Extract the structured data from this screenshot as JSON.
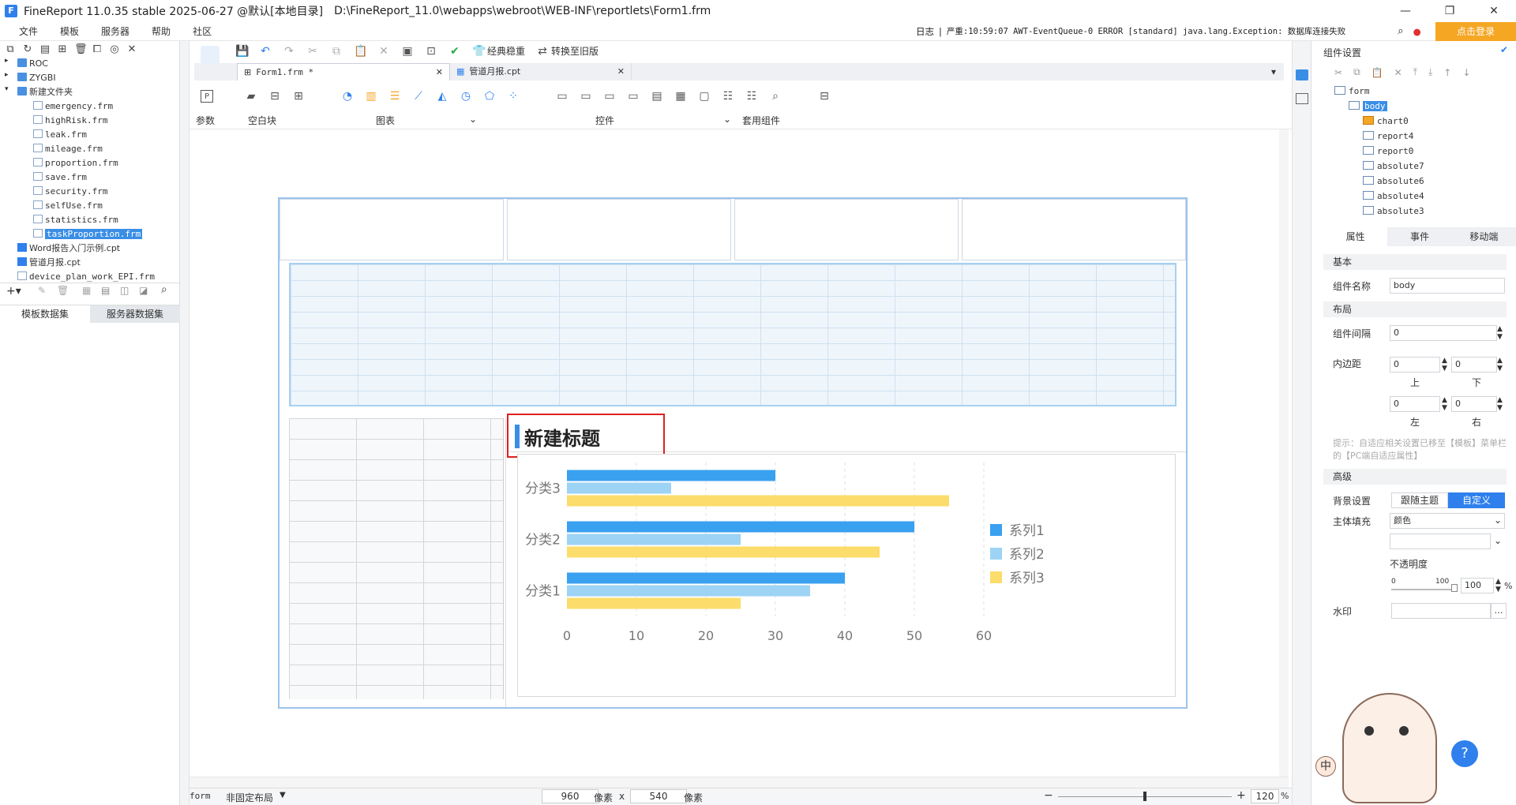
{
  "window": {
    "app_name": "FineReport 11.0.35 stable 2025-06-27 @默认[本地目录]",
    "file_path": "D:\\FineReport_11.0\\webapps\\webroot\\WEB-INF\\reportlets\\Form1.frm",
    "min": "—",
    "max": "❐",
    "close": "✕"
  },
  "menu": [
    "文件",
    "模板",
    "服务器",
    "帮助",
    "社区"
  ],
  "status": {
    "log_label": "日志",
    "separator": "|",
    "message": "严重:10:59:07 AWT-EventQueue-0 ERROR [standard] java.lang.Exception: 数据库连接失败",
    "login": "点击登录"
  },
  "left_tree": [
    {
      "label": "ROC",
      "type": "folder",
      "indent": 0
    },
    {
      "label": "ZYGBI",
      "type": "folder",
      "indent": 0
    },
    {
      "label": "新建文件夹",
      "type": "folder",
      "indent": 0
    },
    {
      "label": "emergency.frm",
      "type": "file",
      "indent": 1
    },
    {
      "label": "highRisk.frm",
      "type": "file",
      "indent": 1
    },
    {
      "label": "leak.frm",
      "type": "file",
      "indent": 1
    },
    {
      "label": "mileage.frm",
      "type": "file",
      "indent": 1
    },
    {
      "label": "proportion.frm",
      "type": "file",
      "indent": 1
    },
    {
      "label": "save.frm",
      "type": "file",
      "indent": 1
    },
    {
      "label": "security.frm",
      "type": "file",
      "indent": 1
    },
    {
      "label": "selfUse.frm",
      "type": "file",
      "indent": 1
    },
    {
      "label": "statistics.frm",
      "type": "file",
      "indent": 1
    },
    {
      "label": "taskProportion.frm",
      "type": "file",
      "indent": 1,
      "selected": true
    },
    {
      "label": "Word报告入门示例.cpt",
      "type": "cpt",
      "indent": 0
    },
    {
      "label": "管道月报.cpt",
      "type": "cpt",
      "indent": 0
    },
    {
      "label": "device_plan_work_EPI.frm",
      "type": "file",
      "indent": 0
    }
  ],
  "left_tabs": [
    "模板数据集",
    "服务器数据集"
  ],
  "toolbar": {
    "classic_stable": "经典稳重",
    "convert_old": "转换至旧版",
    "tab_form1": "Form1.frm *",
    "tab_monthly": "管道月报.cpt",
    "sections": [
      "参数",
      "空白块",
      "图表",
      "控件",
      "套用组件"
    ]
  },
  "chart_title": "新建标题",
  "chart_data": {
    "type": "bar",
    "orientation": "horizontal",
    "title": "",
    "categories": [
      "分类1",
      "分类2",
      "分类3"
    ],
    "series": [
      {
        "name": "系列1",
        "values": [
          40,
          50,
          30
        ],
        "color": "#3aa0f0"
      },
      {
        "name": "系列2",
        "values": [
          35,
          25,
          15
        ],
        "color": "#9dd3f5"
      },
      {
        "name": "系列3",
        "values": [
          25,
          45,
          55
        ],
        "color": "#fcdc6a"
      }
    ],
    "x_ticks": [
      "0",
      "10",
      "20",
      "30",
      "40",
      "50",
      "60"
    ],
    "xlim": [
      0,
      60
    ],
    "legend": "right",
    "grid": "vertical dashed"
  },
  "right_panel": {
    "title": "组件设置",
    "tree": [
      {
        "label": "form",
        "level": 0
      },
      {
        "label": "body",
        "level": 1,
        "selected": true
      },
      {
        "label": "chart0",
        "level": 2
      },
      {
        "label": "report4",
        "level": 2
      },
      {
        "label": "report0",
        "level": 2
      },
      {
        "label": "absolute7",
        "level": 2
      },
      {
        "label": "absolute6",
        "level": 2
      },
      {
        "label": "absolute4",
        "level": 2
      },
      {
        "label": "absolute3",
        "level": 2
      }
    ],
    "tabs": [
      "属性",
      "事件",
      "移动端"
    ],
    "basic": "基本",
    "name_label": "组件名称",
    "name_value": "body",
    "layout": "布局",
    "gap_label": "组件间隔",
    "gap_value": "0",
    "padding_label": "内边距",
    "pad_top": "0",
    "pad_bottom": "0",
    "pad_left": "0",
    "pad_right": "0",
    "top": "上",
    "bottom": "下",
    "left": "左",
    "right": "右",
    "hint": "提示：自适应相关设置已移至【模板】菜单栏的【PC端自适应属性】",
    "advanced": "高级",
    "bg_label": "背景设置",
    "follow_theme": "跟随主题",
    "custom": "自定义",
    "fill_label": "主体填充",
    "fill_value": "颜色",
    "opacity_label": "不透明度",
    "slider_min": "0",
    "slider_max": "100",
    "opacity_value": "100",
    "percent": "%",
    "watermark_label": "水印"
  },
  "bottom": {
    "mode_form": "form",
    "layout": "非固定布局",
    "width": "960",
    "px1": "像素",
    "x": "x",
    "height": "540",
    "px2": "像素",
    "zoom": "120",
    "zoom_pct": "%",
    "minus": "−",
    "plus": "+"
  },
  "misc": {
    "zh_badge": "中",
    "help": "?"
  }
}
